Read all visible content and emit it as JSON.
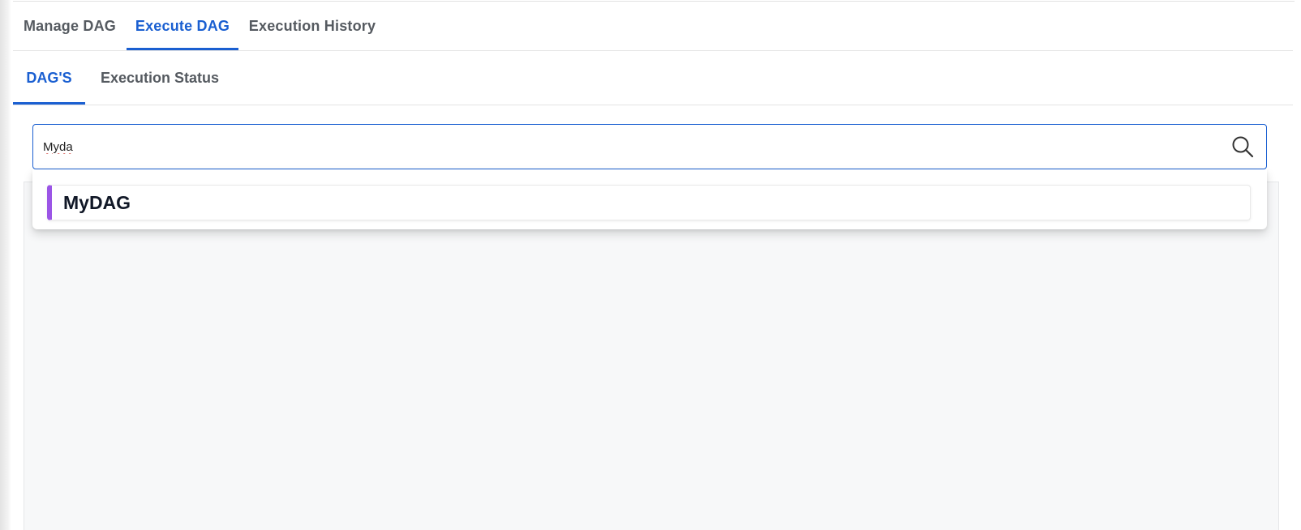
{
  "tabs": [
    {
      "label": "Manage DAG",
      "active": false
    },
    {
      "label": "Execute DAG",
      "active": true
    },
    {
      "label": "Execution History",
      "active": false
    }
  ],
  "sub_tabs": [
    {
      "label": "DAG'S",
      "active": true
    },
    {
      "label": "Execution Status",
      "active": false
    }
  ],
  "search": {
    "value": "Myda",
    "icon": "search-icon"
  },
  "dropdown": {
    "items": [
      {
        "label": "MyDAG",
        "accent_color": "#9b55e6"
      }
    ]
  },
  "colors": {
    "accent": "#1a5fd1",
    "tab_text": "#555a60",
    "panel_bg": "#f7f8f9"
  }
}
